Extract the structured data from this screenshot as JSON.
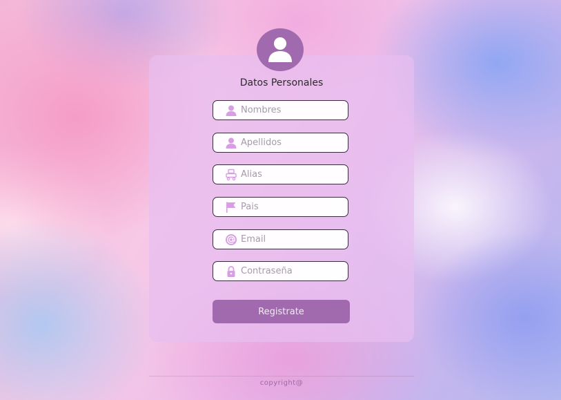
{
  "form": {
    "title": "Datos Personales",
    "fields": [
      {
        "name": "nombres",
        "placeholder": "Nombres",
        "icon": "user-icon"
      },
      {
        "name": "apellidos",
        "placeholder": "Apellidos",
        "icon": "user-icon"
      },
      {
        "name": "alias",
        "placeholder": "Alias",
        "icon": "badge-icon"
      },
      {
        "name": "pais",
        "placeholder": "Pais",
        "icon": "flag-icon"
      },
      {
        "name": "email",
        "placeholder": "Email",
        "icon": "at-icon"
      },
      {
        "name": "contrasena",
        "placeholder": "Contraseña",
        "icon": "lock-icon"
      }
    ],
    "submit_label": "Registrate"
  },
  "footer": {
    "copyright": "copyright@"
  },
  "colors": {
    "accent": "#a16aae",
    "icon": "#d79ee3",
    "card": "#e8bef0"
  }
}
